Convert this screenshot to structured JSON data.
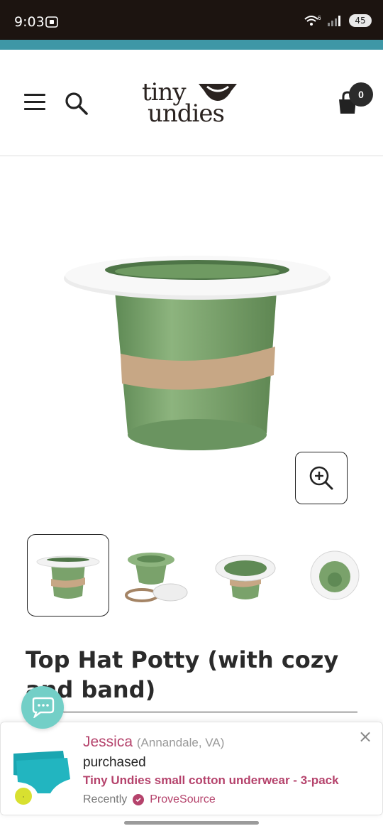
{
  "status_bar": {
    "time": "9:03",
    "battery": "45",
    "wifi_label": "6"
  },
  "header": {
    "logo_line1": "tiny",
    "logo_line2": "undies",
    "logo_mark": "®",
    "cart_count": "0",
    "menu_icon": "hamburger-menu-icon",
    "search_icon": "search-icon",
    "cart_icon": "shopping-bag-icon"
  },
  "product": {
    "title": "Top Hat Potty (with cozy and band)",
    "thumbnails": [
      "potty-front",
      "potty-parts",
      "potty-top-angle",
      "potty-top-down"
    ],
    "active_thumbnail": 0
  },
  "popup": {
    "name": "Jessica",
    "location": "(Annandale, VA)",
    "action": "purchased",
    "product": "Tiny Undies small cotton underwear - 3-pack",
    "recency": "Recently",
    "source": "ProveSource",
    "close": "×"
  },
  "colors": {
    "teal": "#3e97a6",
    "accent": "#b5436c",
    "chat": "#73cfc7",
    "potty_green": "#7aa26b"
  }
}
